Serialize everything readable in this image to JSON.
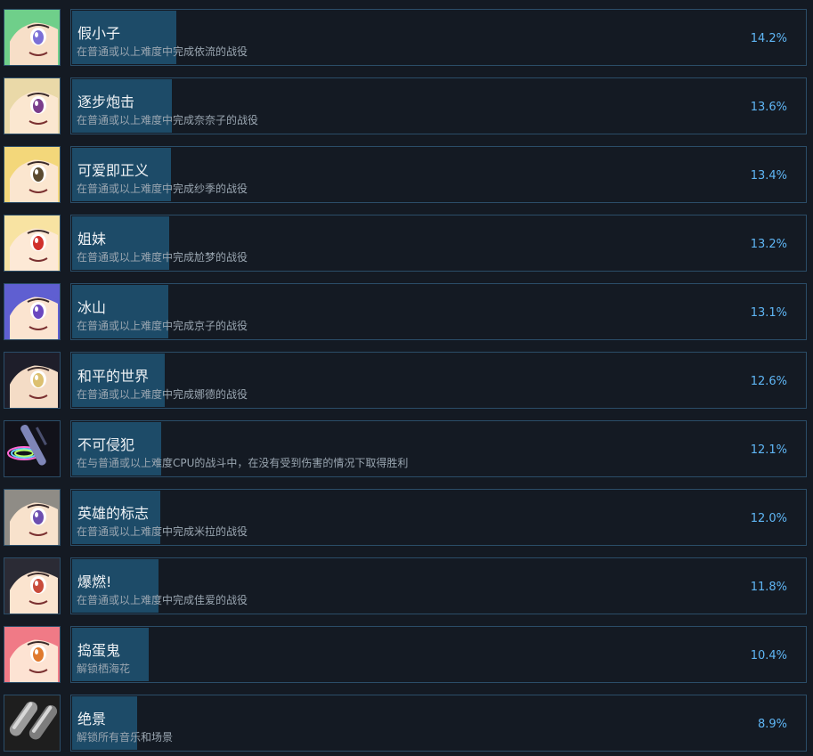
{
  "achievements": [
    {
      "title": "假小子",
      "desc": "在普通或以上难度中完成依流的战役",
      "percent": "14.2%",
      "fill": 0.142,
      "icon": "anime-portrait-green-hair-icon",
      "colors": {
        "hair": "#6fcf8a",
        "skin": "#f7dfc8",
        "eye": "#7b6fd6"
      }
    },
    {
      "title": "逐步炮击",
      "desc": "在普通或以上难度中完成奈奈子的战役",
      "percent": "13.6%",
      "fill": 0.136,
      "icon": "anime-portrait-grin-icon",
      "colors": {
        "hair": "#ead9a8",
        "skin": "#fbe7d0",
        "eye": "#7a3d8c"
      }
    },
    {
      "title": "可爱即正义",
      "desc": "在普通或以上难度中完成纱季的战役",
      "percent": "13.4%",
      "fill": 0.134,
      "icon": "anime-portrait-blonde-icon",
      "colors": {
        "hair": "#f3d77a",
        "skin": "#fbe6cf",
        "eye": "#5a4a30"
      }
    },
    {
      "title": "姐妹",
      "desc": "在普通或以上难度中完成尬梦的战役",
      "percent": "13.2%",
      "fill": 0.132,
      "icon": "anime-portrait-red-eye-icon",
      "colors": {
        "hair": "#f8e3a2",
        "skin": "#fde9d6",
        "eye": "#d0302c"
      }
    },
    {
      "title": "冰山",
      "desc": "在普通或以上难度中完成京子的战役",
      "percent": "13.1%",
      "fill": 0.131,
      "icon": "anime-portrait-glasses-icon",
      "colors": {
        "hair": "#5f5fd1",
        "skin": "#fbe4d0",
        "eye": "#6a48c0"
      }
    },
    {
      "title": "和平的世界",
      "desc": "在普通或以上难度中完成娜德的战役",
      "percent": "12.6%",
      "fill": 0.126,
      "icon": "anime-portrait-dark-hair-icon",
      "colors": {
        "hair": "#1e1e2a",
        "skin": "#f4dcc6",
        "eye": "#dcc070"
      }
    },
    {
      "title": "不可侵犯",
      "desc": "在与普通或以上难度CPU的战斗中，在没有受到伤害的情况下取得胜利",
      "percent": "12.1%",
      "fill": 0.121,
      "icon": "rainbow-ring-icon",
      "colors": {
        "hair": "#1a1a22",
        "skin": "#9aa4d8",
        "eye": "#c070e0"
      }
    },
    {
      "title": "英雄的标志",
      "desc": "在普通或以上难度中完成米拉的战役",
      "percent": "12.0%",
      "fill": 0.12,
      "icon": "anime-portrait-grey-hair-icon",
      "colors": {
        "hair": "#8f8c86",
        "skin": "#f8e2cc",
        "eye": "#6d4fb0"
      }
    },
    {
      "title": "爆燃!",
      "desc": "在普通或以上难度中完成佳爱的战役",
      "percent": "11.8%",
      "fill": 0.118,
      "icon": "anime-portrait-shouting-icon",
      "colors": {
        "hair": "#2b2b35",
        "skin": "#fbe4cf",
        "eye": "#c94b3b"
      }
    },
    {
      "title": "捣蛋鬼",
      "desc": "解锁栖海花",
      "percent": "10.4%",
      "fill": 0.104,
      "icon": "anime-portrait-pink-hair-icon",
      "colors": {
        "hair": "#f07a86",
        "skin": "#fde3d3",
        "eye": "#e07a2e"
      }
    },
    {
      "title": "绝景",
      "desc": "解锁所有音乐和场景",
      "percent": "8.9%",
      "fill": 0.089,
      "icon": "grey-capsules-icon",
      "colors": {
        "hair": "#9a9a9a",
        "skin": "#1e1e1e",
        "eye": "#d8d8d8"
      }
    }
  ]
}
